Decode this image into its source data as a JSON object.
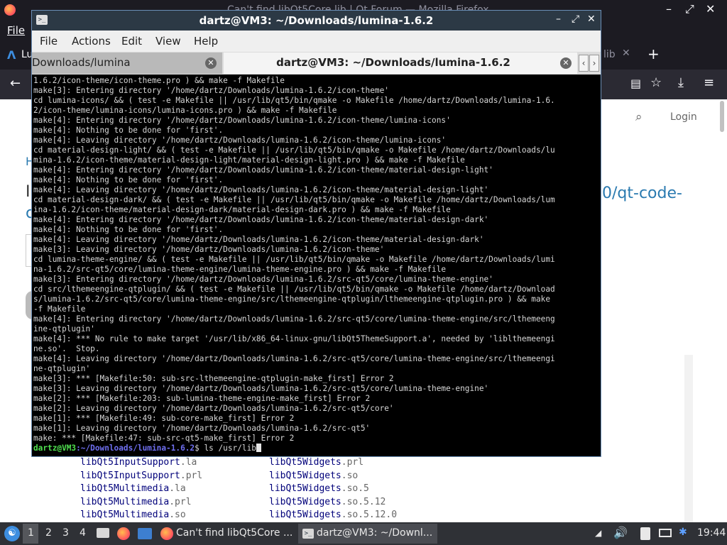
{
  "firefox": {
    "window_title": "Can't find libQt5Core.lib | Qt Forum — Mozilla Firefox",
    "menu_file": "File",
    "tab_left": "Lu",
    "tab_right": "lib",
    "login": "Login",
    "link_fragment_1": "0/qt-code-",
    "link_fragment_2": "c",
    "heading_fragment": "H",
    "heading_fragment_2": "I"
  },
  "page_listing": {
    "col1": [
      {
        "name": "libQt5InputSupport",
        "ext": ".la"
      },
      {
        "name": "libQt5InputSupport",
        "ext": ".prl"
      },
      {
        "name": "libQt5Multimedia",
        "ext": ".la"
      },
      {
        "name": "libQt5Multimedia",
        "ext": ".prl"
      },
      {
        "name": "libQt5Multimedia",
        "ext": ".so"
      }
    ],
    "col2": [
      {
        "name": "libQt5Widgets",
        "ext": ".prl"
      },
      {
        "name": "libQt5Widgets",
        "ext": ".so"
      },
      {
        "name": "libQt5Widgets",
        "ext": ".so.5"
      },
      {
        "name": "libQt5Widgets",
        "ext": ".so.5.12"
      },
      {
        "name": "libQt5Widgets",
        "ext": ".so.5.12.0"
      }
    ]
  },
  "terminal": {
    "title": "dartz@VM3: ~/Downloads/lumina-1.6.2",
    "menu": [
      "File",
      "Actions",
      "Edit",
      "View",
      "Help"
    ],
    "tab1_label": "Downloads/lumina",
    "tab2_label": "dartz@VM3: ~/Downloads/lumina-1.6.2",
    "lines": [
      "1.6.2/icon-theme/icon-theme.pro ) && make -f Makefile",
      "make[3]: Entering directory '/home/dartz/Downloads/lumina-1.6.2/icon-theme'",
      "cd lumina-icons/ && ( test -e Makefile || /usr/lib/qt5/bin/qmake -o Makefile /home/dartz/Downloads/lumina-1.6.",
      "2/icon-theme/lumina-icons/lumina-icons.pro ) && make -f Makefile",
      "make[4]: Entering directory '/home/dartz/Downloads/lumina-1.6.2/icon-theme/lumina-icons'",
      "make[4]: Nothing to be done for 'first'.",
      "make[4]: Leaving directory '/home/dartz/Downloads/lumina-1.6.2/icon-theme/lumina-icons'",
      "cd material-design-light/ && ( test -e Makefile || /usr/lib/qt5/bin/qmake -o Makefile /home/dartz/Downloads/lu",
      "mina-1.6.2/icon-theme/material-design-light/material-design-light.pro ) && make -f Makefile",
      "make[4]: Entering directory '/home/dartz/Downloads/lumina-1.6.2/icon-theme/material-design-light'",
      "make[4]: Nothing to be done for 'first'.",
      "make[4]: Leaving directory '/home/dartz/Downloads/lumina-1.6.2/icon-theme/material-design-light'",
      "cd material-design-dark/ && ( test -e Makefile || /usr/lib/qt5/bin/qmake -o Makefile /home/dartz/Downloads/lum",
      "ina-1.6.2/icon-theme/material-design-dark/material-design-dark.pro ) && make -f Makefile",
      "make[4]: Entering directory '/home/dartz/Downloads/lumina-1.6.2/icon-theme/material-design-dark'",
      "make[4]: Nothing to be done for 'first'.",
      "make[4]: Leaving directory '/home/dartz/Downloads/lumina-1.6.2/icon-theme/material-design-dark'",
      "make[3]: Leaving directory '/home/dartz/Downloads/lumina-1.6.2/icon-theme'",
      "cd lumina-theme-engine/ && ( test -e Makefile || /usr/lib/qt5/bin/qmake -o Makefile /home/dartz/Downloads/lumi",
      "na-1.6.2/src-qt5/core/lumina-theme-engine/lumina-theme-engine.pro ) && make -f Makefile",
      "make[3]: Entering directory '/home/dartz/Downloads/lumina-1.6.2/src-qt5/core/lumina-theme-engine'",
      "cd src/lthemeengine-qtplugin/ && ( test -e Makefile || /usr/lib/qt5/bin/qmake -o Makefile /home/dartz/Download",
      "s/lumina-1.6.2/src-qt5/core/lumina-theme-engine/src/lthemeengine-qtplugin/lthemeengine-qtplugin.pro ) && make",
      "-f Makefile",
      "make[4]: Entering directory '/home/dartz/Downloads/lumina-1.6.2/src-qt5/core/lumina-theme-engine/src/lthemeeng",
      "ine-qtplugin'",
      "make[4]: *** No rule to make target '/usr/lib/x86_64-linux-gnu/libQt5ThemeSupport.a', needed by 'liblthemeengi",
      "ne.so'.  Stop.",
      "make[4]: Leaving directory '/home/dartz/Downloads/lumina-1.6.2/src-qt5/core/lumina-theme-engine/src/lthemeengi",
      "ne-qtplugin'",
      "make[3]: *** [Makefile:50: sub-src-lthemeengine-qtplugin-make_first] Error 2",
      "make[3]: Leaving directory '/home/dartz/Downloads/lumina-1.6.2/src-qt5/core/lumina-theme-engine'",
      "make[2]: *** [Makefile:203: sub-lumina-theme-engine-make_first] Error 2",
      "make[2]: Leaving directory '/home/dartz/Downloads/lumina-1.6.2/src-qt5/core'",
      "make[1]: *** [Makefile:49: sub-core-make_first] Error 2",
      "make[1]: Leaving directory '/home/dartz/Downloads/lumina-1.6.2/src-qt5'",
      "make: *** [Makefile:47: sub-src-qt5-make_first] Error 2"
    ],
    "prompt_user": "dartz@VM3",
    "prompt_path": ":~/Downloads/lumina-1.6.2",
    "command": "$ ls /usr/lib"
  },
  "taskbar": {
    "workspaces": [
      "1",
      "2",
      "3",
      "4"
    ],
    "task_firefox": "Can't find libQt5Core ...",
    "task_terminal": "dartz@VM3: ~/Downl...",
    "clock": "19:44"
  }
}
